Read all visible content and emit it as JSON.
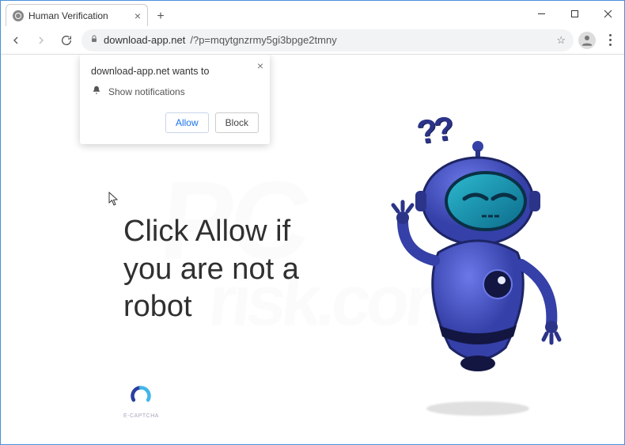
{
  "window": {
    "tab_title": "Human Verification",
    "close": "×",
    "new_tab_glyph": "+"
  },
  "toolbar": {
    "url_host": "download-app.net",
    "url_rest": "/?p=mqytgnzrmy5gi3bpge2tmny",
    "star": "☆"
  },
  "popup": {
    "origin_text": "download-app.net wants to",
    "perm_text": "Show notifications",
    "allow_label": "Allow",
    "block_label": "Block",
    "close": "×"
  },
  "page": {
    "headline_l1": "Click Allow if",
    "headline_l2": "you are not a",
    "headline_l3": "robot",
    "captcha_label": "E-CAPTCHA",
    "qmarks": "??"
  },
  "watermark": {
    "l1": "PC",
    "l2": "risk.com"
  }
}
